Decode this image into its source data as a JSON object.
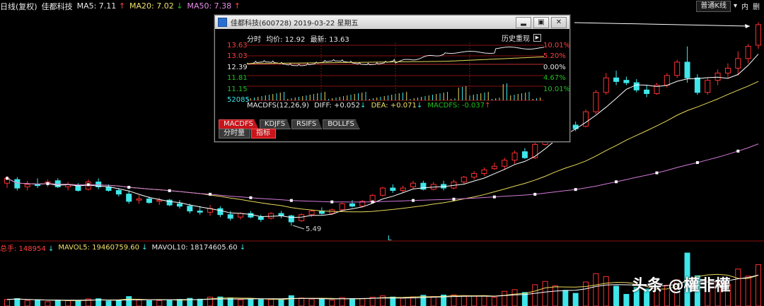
{
  "header": {
    "period_label": "日线(复权)",
    "stock_name": "佳都科技",
    "ma5_label": "MA5: 7.11",
    "ma5_arrow": "↑",
    "ma20_label": "MA20: 7.02",
    "ma20_arrow": "↓",
    "ma50_label": "MA50: 7.38",
    "ma50_arrow": "↑",
    "mode_button": "普通K线",
    "btn_inner": "内",
    "btn_delete": "删"
  },
  "chart": {
    "low_marker": "5.49",
    "marker_L": "L",
    "colors": {
      "up": "#ff3030",
      "down": "#3fe6ea",
      "ma5": "#ffffff",
      "ma20": "#e8d85a",
      "ma50": "#d27ad8"
    },
    "candles": [
      {
        "o": 7.25,
        "h": 7.55,
        "l": 7.05,
        "c": 7.45
      },
      {
        "o": 7.4,
        "h": 7.5,
        "l": 6.95,
        "c": 7.05
      },
      {
        "o": 7.1,
        "h": 7.35,
        "l": 6.95,
        "c": 7.2
      },
      {
        "o": 7.2,
        "h": 7.45,
        "l": 7.05,
        "c": 7.15
      },
      {
        "o": 7.25,
        "h": 7.4,
        "l": 7.1,
        "c": 7.3
      },
      {
        "o": 7.35,
        "h": 7.45,
        "l": 7.05,
        "c": 7.1
      },
      {
        "o": 7.1,
        "h": 7.3,
        "l": 6.95,
        "c": 7.2
      },
      {
        "o": 7.15,
        "h": 7.25,
        "l": 6.9,
        "c": 6.95
      },
      {
        "o": 7.0,
        "h": 7.4,
        "l": 6.95,
        "c": 7.3
      },
      {
        "o": 7.3,
        "h": 7.45,
        "l": 7.0,
        "c": 7.1
      },
      {
        "o": 7.1,
        "h": 7.2,
        "l": 6.9,
        "c": 6.95
      },
      {
        "o": 6.95,
        "h": 7.05,
        "l": 6.7,
        "c": 6.8
      },
      {
        "o": 6.8,
        "h": 6.95,
        "l": 6.4,
        "c": 6.5
      },
      {
        "o": 6.55,
        "h": 6.75,
        "l": 6.4,
        "c": 6.6
      },
      {
        "o": 6.6,
        "h": 6.7,
        "l": 6.4,
        "c": 6.45
      },
      {
        "o": 6.5,
        "h": 6.65,
        "l": 6.35,
        "c": 6.55
      },
      {
        "o": 6.55,
        "h": 6.6,
        "l": 6.3,
        "c": 6.35
      },
      {
        "o": 6.4,
        "h": 6.55,
        "l": 6.2,
        "c": 6.3
      },
      {
        "o": 6.3,
        "h": 6.4,
        "l": 6.0,
        "c": 6.1
      },
      {
        "o": 6.1,
        "h": 6.3,
        "l": 5.95,
        "c": 6.05
      },
      {
        "o": 6.05,
        "h": 6.35,
        "l": 5.9,
        "c": 6.2
      },
      {
        "o": 6.2,
        "h": 6.3,
        "l": 5.85,
        "c": 5.95
      },
      {
        "o": 5.95,
        "h": 6.1,
        "l": 5.7,
        "c": 5.8
      },
      {
        "o": 5.85,
        "h": 6.05,
        "l": 5.75,
        "c": 6.0
      },
      {
        "o": 6.0,
        "h": 6.1,
        "l": 5.8,
        "c": 5.85
      },
      {
        "o": 5.85,
        "h": 5.95,
        "l": 5.65,
        "c": 5.75
      },
      {
        "o": 5.8,
        "h": 6.05,
        "l": 5.75,
        "c": 6.0
      },
      {
        "o": 6.0,
        "h": 6.1,
        "l": 5.8,
        "c": 5.9
      },
      {
        "o": 5.9,
        "h": 5.95,
        "l": 5.49,
        "c": 5.65
      },
      {
        "o": 5.7,
        "h": 6.0,
        "l": 5.65,
        "c": 5.95
      },
      {
        "o": 5.95,
        "h": 6.15,
        "l": 5.85,
        "c": 6.1
      },
      {
        "o": 6.1,
        "h": 6.25,
        "l": 5.95,
        "c": 6.0
      },
      {
        "o": 6.0,
        "h": 6.2,
        "l": 5.95,
        "c": 6.15
      },
      {
        "o": 6.15,
        "h": 6.45,
        "l": 6.1,
        "c": 6.4
      },
      {
        "o": 6.4,
        "h": 6.55,
        "l": 6.25,
        "c": 6.3
      },
      {
        "o": 6.3,
        "h": 6.55,
        "l": 6.25,
        "c": 6.5
      },
      {
        "o": 6.5,
        "h": 6.8,
        "l": 6.45,
        "c": 6.75
      },
      {
        "o": 6.75,
        "h": 7.1,
        "l": 6.7,
        "c": 7.05
      },
      {
        "o": 7.05,
        "h": 7.2,
        "l": 6.85,
        "c": 6.95
      },
      {
        "o": 6.95,
        "h": 7.15,
        "l": 6.85,
        "c": 7.05
      },
      {
        "o": 7.1,
        "h": 7.35,
        "l": 7.0,
        "c": 7.25
      },
      {
        "o": 7.25,
        "h": 7.35,
        "l": 6.95,
        "c": 7.0
      },
      {
        "o": 7.0,
        "h": 7.3,
        "l": 6.95,
        "c": 7.2
      },
      {
        "o": 7.2,
        "h": 7.35,
        "l": 6.95,
        "c": 7.05
      },
      {
        "o": 7.05,
        "h": 7.4,
        "l": 7.0,
        "c": 7.3
      },
      {
        "o": 7.3,
        "h": 7.55,
        "l": 7.2,
        "c": 7.5
      },
      {
        "o": 7.5,
        "h": 7.75,
        "l": 7.4,
        "c": 7.65
      },
      {
        "o": 7.65,
        "h": 7.9,
        "l": 7.55,
        "c": 7.8
      },
      {
        "o": 7.85,
        "h": 8.1,
        "l": 7.8,
        "c": 7.95
      },
      {
        "o": 7.95,
        "h": 8.3,
        "l": 7.8,
        "c": 8.2
      },
      {
        "o": 8.2,
        "h": 8.6,
        "l": 8.05,
        "c": 8.5
      },
      {
        "o": 8.55,
        "h": 8.7,
        "l": 8.25,
        "c": 8.3
      },
      {
        "o": 8.3,
        "h": 8.95,
        "l": 8.25,
        "c": 8.85
      },
      {
        "o": 8.85,
        "h": 9.6,
        "l": 8.8,
        "c": 9.5
      },
      {
        "o": 9.5,
        "h": 10.05,
        "l": 9.4,
        "c": 9.95
      },
      {
        "o": 9.9,
        "h": 10.0,
        "l": 9.5,
        "c": 9.65
      },
      {
        "o": 9.65,
        "h": 9.8,
        "l": 9.4,
        "c": 9.5
      },
      {
        "o": 9.6,
        "h": 10.3,
        "l": 9.55,
        "c": 10.2
      },
      {
        "o": 10.2,
        "h": 11.1,
        "l": 10.1,
        "c": 11.0
      },
      {
        "o": 11.0,
        "h": 11.8,
        "l": 10.9,
        "c": 11.6
      },
      {
        "o": 11.6,
        "h": 11.9,
        "l": 11.3,
        "c": 11.45
      },
      {
        "o": 11.5,
        "h": 11.65,
        "l": 11.3,
        "c": 11.4
      },
      {
        "o": 11.4,
        "h": 11.55,
        "l": 11.0,
        "c": 11.1
      },
      {
        "o": 11.1,
        "h": 11.3,
        "l": 10.8,
        "c": 10.95
      },
      {
        "o": 10.95,
        "h": 11.4,
        "l": 10.9,
        "c": 11.3
      },
      {
        "o": 11.3,
        "h": 11.8,
        "l": 11.2,
        "c": 11.7
      },
      {
        "o": 11.7,
        "h": 12.35,
        "l": 11.6,
        "c": 12.25
      },
      {
        "o": 12.25,
        "h": 12.9,
        "l": 11.4,
        "c": 11.6
      },
      {
        "o": 11.6,
        "h": 11.75,
        "l": 10.9,
        "c": 11.0
      },
      {
        "o": 11.0,
        "h": 11.6,
        "l": 10.9,
        "c": 11.5
      },
      {
        "o": 11.5,
        "h": 11.95,
        "l": 11.3,
        "c": 11.8
      },
      {
        "o": 11.8,
        "h": 12.2,
        "l": 11.6,
        "c": 12.0
      },
      {
        "o": 12.0,
        "h": 12.7,
        "l": 11.7,
        "c": 12.4
      },
      {
        "o": 12.4,
        "h": 13.0,
        "l": 12.2,
        "c": 12.9
      },
      {
        "o": 12.95,
        "h": 13.9,
        "l": 12.8,
        "c": 13.8
      }
    ]
  },
  "volume": {
    "total_label": "总手: 148954",
    "total_arrow": "↓",
    "mavol5_label": "MAVOL5: 19460759.60",
    "mavol5_arrow": "↓",
    "mavol10_label": "MAVOL10: 18174605.60",
    "mavol10_arrow": "↓"
  },
  "popup": {
    "title": "佳都科技(600728)  2019-03-22 星期五",
    "title_min": "▂",
    "title_max": "▣",
    "title_close": "✕",
    "fenshi_label": "分时",
    "avg_label": "均价: 12.92",
    "latest_label": "最新: 13.63",
    "history_button": "历史重现",
    "dock_icon": "▶",
    "price_labels": [
      "13.63",
      "13.03",
      "12.39",
      "11.81",
      "11.15"
    ],
    "pct_labels": [
      "10.01%",
      "5.20%",
      "0.00%",
      "4.67%",
      "10.01%"
    ],
    "volume_label": "52085",
    "macd_name": "MACDFS(12,26,9)",
    "diff_label": "DIFF: +0.052",
    "diff_arrow": "↓",
    "dea_label": "DEA: +0.071",
    "dea_arrow": "↓",
    "macd_label": "MACDFS: -0.037",
    "macd_arrow": "↑",
    "tabs": [
      "MACDFS",
      "KDJFS",
      "RSIFS",
      "BOLLFS"
    ],
    "bottom_tabs": [
      "分时量",
      "指标"
    ]
  },
  "watermark": "头条 @權非權"
}
